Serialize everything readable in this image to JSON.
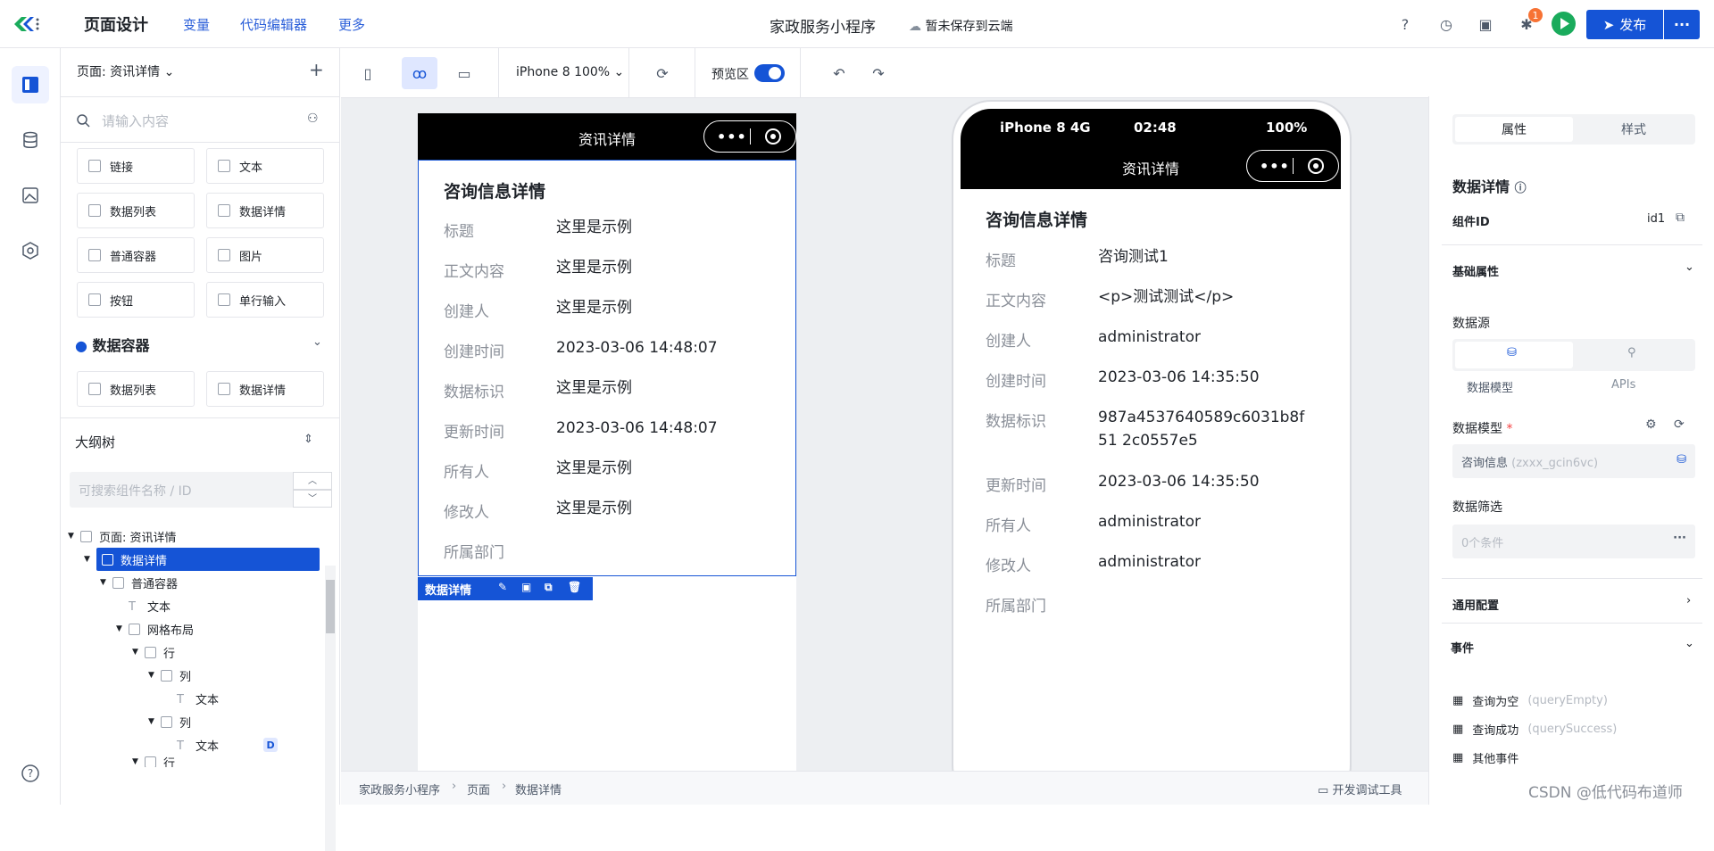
{
  "topbar": {
    "main_menu": "页面设计",
    "menu_items": [
      "变量",
      "代码编辑器",
      "更多"
    ],
    "app_title": "家政服务小程序",
    "save_state": "暂未保存到云端",
    "notification_count": "1",
    "publish_label": "发布",
    "more_label": "···",
    "accent": "#1554d6"
  },
  "left_panel": {
    "page_select": "页面: 资讯详情",
    "search_placeholder": "请输入内容",
    "components": [
      "链接",
      "文本",
      "数据列表",
      "数据详情",
      "普通容器",
      "图片",
      "按钮",
      "单行输入"
    ],
    "data_container_title": "数据容器",
    "data_components": [
      "数据列表",
      "数据详情"
    ],
    "outline_title": "大纲树",
    "outline_search_placeholder": "可搜索组件名称 / ID",
    "tree": [
      {
        "label": "页面: 资讯详情"
      },
      {
        "label": "数据详情",
        "selected": true
      },
      {
        "label": "普通容器"
      },
      {
        "label": "文本"
      },
      {
        "label": "网格布局"
      },
      {
        "label": "行"
      },
      {
        "label": "列"
      },
      {
        "label": "文本"
      },
      {
        "label": "列"
      },
      {
        "label": "文本",
        "badge": "D"
      },
      {
        "label": "行"
      }
    ]
  },
  "toolbar": {
    "device": "iPhone 8 100%",
    "preview_label": "预览区",
    "preview_on": true
  },
  "design_phone": {
    "nav_title": "资讯详情",
    "detail_title": "咨询信息详情",
    "rows": [
      {
        "label": "标题",
        "value": "这里是示例"
      },
      {
        "label": "正文内容",
        "value": "这里是示例"
      },
      {
        "label": "创建人",
        "value": "这里是示例"
      },
      {
        "label": "创建时间",
        "value": "2023-03-06 14:48:07"
      },
      {
        "label": "数据标识",
        "value": "这里是示例"
      },
      {
        "label": "更新时间",
        "value": "2023-03-06 14:48:07"
      },
      {
        "label": "所有人",
        "value": "这里是示例"
      },
      {
        "label": "修改人",
        "value": "这里是示例"
      },
      {
        "label": "所属部门",
        "value": ""
      }
    ],
    "selection_label": "数据详情"
  },
  "preview_phone": {
    "carrier": "iPhone 8  4G",
    "time": "02:48",
    "battery": "100%",
    "nav_title": "资讯详情",
    "detail_title": "咨询信息详情",
    "rows": [
      {
        "label": "标题",
        "value": "咨询测试1"
      },
      {
        "label": "正文内容",
        "value": "<p>测试测试</p>"
      },
      {
        "label": "创建人",
        "value": "administrator"
      },
      {
        "label": "创建时间",
        "value": "2023-03-06 14:35:50"
      },
      {
        "label": "数据标识",
        "value": "987a4537640589c6031b8f51 2c0557e5"
      },
      {
        "label": "更新时间",
        "value": "2023-03-06 14:35:50"
      },
      {
        "label": "所有人",
        "value": "administrator"
      },
      {
        "label": "修改人",
        "value": "administrator"
      },
      {
        "label": "所属部门",
        "value": ""
      }
    ]
  },
  "breadcrumb": {
    "items": [
      "家政服务小程序",
      "页面",
      "数据详情"
    ],
    "devtools": "开发调试工具"
  },
  "right_panel": {
    "tabs": [
      "属性",
      "样式"
    ],
    "component_title": "数据详情",
    "component_id_label": "组件ID",
    "component_id": "id1",
    "basic_section": "基础属性",
    "datasource_label": "数据源",
    "datasource_options": [
      "数据模型",
      "APIs"
    ],
    "model_label": "数据模型",
    "model_value": "咨询信息",
    "model_id": "(zxxx_gcin6vc)",
    "filter_label": "数据筛选",
    "filter_value": "0个条件",
    "general_section": "通用配置",
    "events_section": "事件",
    "events": [
      {
        "name": "查询为空",
        "code": "(queryEmpty)"
      },
      {
        "name": "查询成功",
        "code": "(querySuccess)"
      },
      {
        "name": "其他事件",
        "code": ""
      }
    ]
  },
  "watermark": "CSDN @低代码布道师"
}
